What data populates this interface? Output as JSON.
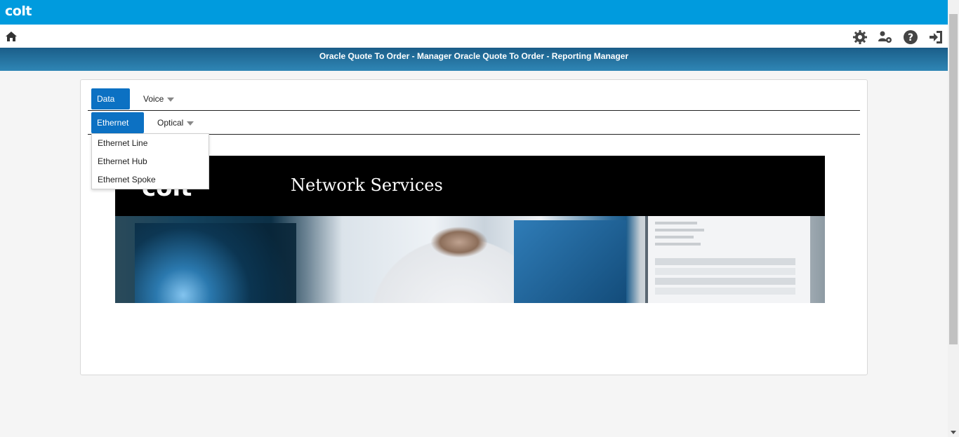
{
  "app": {
    "logo": "colt",
    "title": "Oracle Quote To Order - Manager Oracle Quote To Order - Reporting Manager"
  },
  "toolbar": {
    "icons": [
      "home-icon",
      "gear-icon",
      "user-settings-icon",
      "help-icon",
      "logout-icon"
    ]
  },
  "tabs": {
    "level1": [
      {
        "label": "Data",
        "active": true
      },
      {
        "label": "Voice",
        "active": false
      }
    ],
    "level2": [
      {
        "label": "Ethernet",
        "active": true
      },
      {
        "label": "Optical",
        "active": false
      }
    ]
  },
  "dropdown": {
    "items": [
      "Ethernet Line",
      "Ethernet Hub",
      "Ethernet Spoke"
    ]
  },
  "banner": {
    "logo": "colt",
    "title": "Network Services"
  },
  "colors": {
    "topbar": "#009bde",
    "accent": "#0c71c3",
    "titlebar": "#1b5f8a"
  }
}
